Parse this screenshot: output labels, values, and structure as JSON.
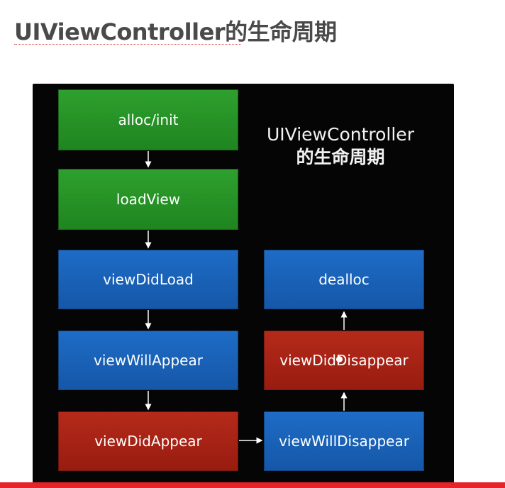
{
  "header": {
    "title": "UIViewController的生命周期"
  },
  "diagram": {
    "title_line1": "UIViewController",
    "title_line2": "的生命周期",
    "nodes": {
      "alloc_init": "alloc/init",
      "load_view": "loadView",
      "view_did_load": "viewDidLoad",
      "view_will_appear": "viewWillAppear",
      "view_did_appear": "viewDidAppear",
      "view_will_disappear": "viewWillDisappear",
      "view_did_disappear": "viewDidDisappear",
      "dealloc": "dealloc"
    },
    "colors": {
      "background": "#050505",
      "green": "#24912a",
      "blue": "#1a63b8",
      "red": "#a82314",
      "arrow": "#ffffff"
    }
  },
  "accent_bar_color": "#e8212b"
}
